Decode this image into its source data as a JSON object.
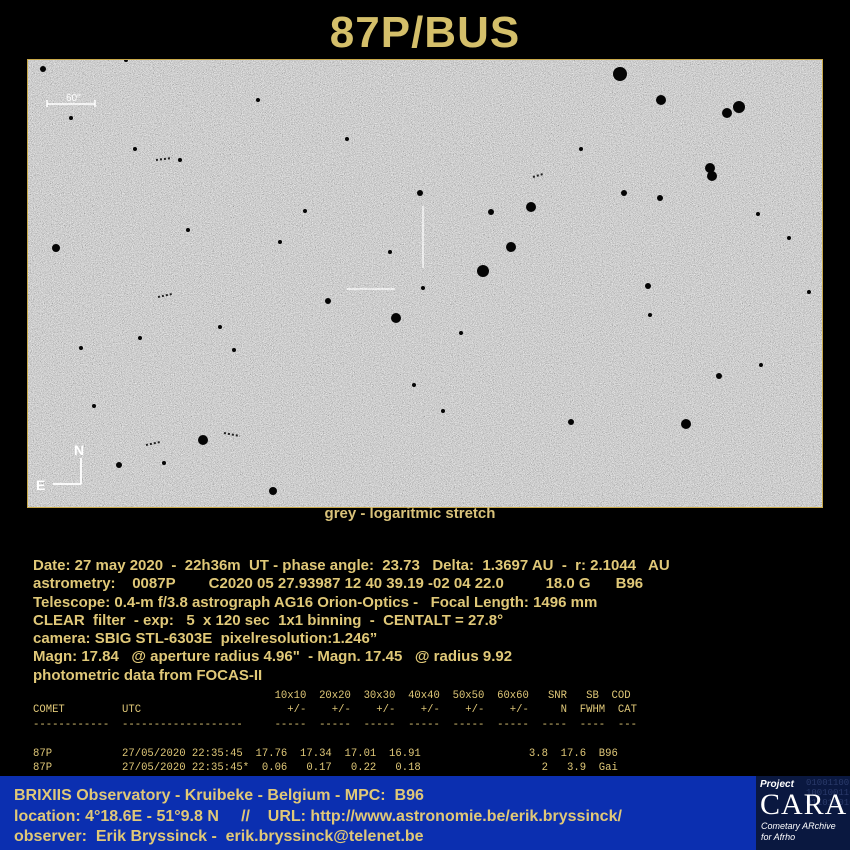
{
  "title": "87P/BUS",
  "image": {
    "scale_label": "60\"",
    "north_label": "N",
    "east_label": "E",
    "caption": "grey -  logaritmic stretch"
  },
  "info_lines": [
    "Date: 27 may 2020  -  22h36m  UT - phase angle:  23.73   Delta:  1.3697 AU  -  r: 2.1044   AU",
    "astrometry:    0087P        C2020 05 27.93987 12 40 39.19 -02 04 22.0          18.0 G      B96",
    "Telescope: 0.4-m f/3.8 astrograph AG16 Orion-Optics -   Focal Length: 1496 mm",
    "CLEAR  filter  - exp:   5  x 120 sec  1x1 binning  -  CENTALT = 27.8°",
    "camera: SBIG STL-6303E  pixelresolution:1.246”",
    "Magn: 17.84   @ aperture radius 4.96\"  - Magn. 17.45   @ radius 9.92",
    "photometric data from FOCAS-II"
  ],
  "photometry": {
    "header1": "                                      10x10  20x20  30x30  40x40  50x50  60x60   SNR   SB  COD",
    "header2": "COMET         UTC                       +/-    +/-    +/-    +/-    +/-    +/-     N  FWHM  CAT",
    "separator": "------------  -------------------     -----  -----  -----  -----  -----  -----  ----  ----  ---",
    "rows": [
      "87P           27/05/2020 22:35:45  17.76  17.34  17.01  16.91                 3.8  17.6  B96",
      "87P           27/05/2020 22:35:45*  0.06   0.17   0.22   0.18                   2   3.9  Gai"
    ]
  },
  "footer": {
    "line1": "BRIXIIS Observatory - Kruibeke - Belgium - MPC:  B96",
    "line2": "location: 4°18.6E - 51°9.8 N     //    URL: http://www.astronomie.be/erik.bryssinck/",
    "line3": "observer:  Erik Bryssinck -  erik.bryssinck@telenet.be"
  },
  "logo": {
    "project": "Project",
    "name": "CARA",
    "sub1": "Cometary ARchive",
    "sub2": "for Afrho",
    "bits": [
      "0100110011001",
      "1001001101101",
      "0110100100110"
    ]
  },
  "colors": {
    "background": "#000000",
    "text": "#e0c878",
    "frame_border": "#c9a94a",
    "footer_bg": "#0b2fb0",
    "sky": "#a9a9a9"
  }
}
